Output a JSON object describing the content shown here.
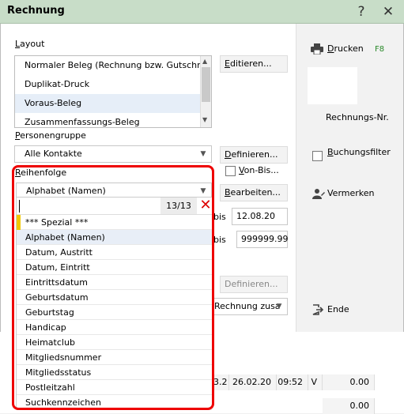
{
  "window": {
    "title": "Rechnung",
    "help_glyph": "?",
    "close_glyph": "✕"
  },
  "layout": {
    "label": "Layout",
    "items": [
      "Normaler Beleg (Rechnung bzw. Gutschrift)",
      "Duplikat-Druck",
      "Voraus-Beleg",
      "Zusammenfassungs-Beleg"
    ],
    "edit_label": "Editieren..."
  },
  "personengruppe": {
    "label": "Personengruppe",
    "value": "Alle Kontakte",
    "define_label": "Definieren...",
    "von_bis_label": "Von-Bis..."
  },
  "reihenfolge": {
    "label": "Reihenfolge",
    "value": "Alphabet (Namen)",
    "edit_label": "Bearbeiten...",
    "search_counter": "13/13",
    "clear_glyph": "✕",
    "options": [
      "*** Spezial ***",
      "Alphabet (Namen)",
      "Datum, Austritt",
      "Datum, Eintritt",
      "Eintrittsdatum",
      "Geburtsdatum",
      "Geburtstag",
      "Handicap",
      "Heimatclub",
      "Mitgliedsnummer",
      "Mitgliedsstatus",
      "Postleitzahl",
      "Suchkennzeichen"
    ],
    "selected_index": 1
  },
  "date_range": {
    "bis_label": "bis",
    "date_to": "12.08.20",
    "number_to": "999999.99"
  },
  "other": {
    "define_disabled_label": "Definieren...",
    "combo_value": "Rechnung zusa"
  },
  "sidebar": {
    "print_label": "Drucken",
    "print_shortcut": "F8",
    "rechnungs_nr_label": "Rechnungs-Nr.",
    "buchungsfilter_label": "Buchungsfilter",
    "vermerken_label": "Vermerken",
    "ende_label": "Ende"
  },
  "background_row": {
    "cells": [
      "3.2",
      "26.02.20",
      "09:52",
      "V",
      "0.00",
      "0.00"
    ]
  },
  "colors": {
    "titlebar": "#c8ddc8",
    "highlight_red": "#e00000",
    "shortcut_green": "#2a8a2a",
    "special_marker": "#f0c800"
  }
}
